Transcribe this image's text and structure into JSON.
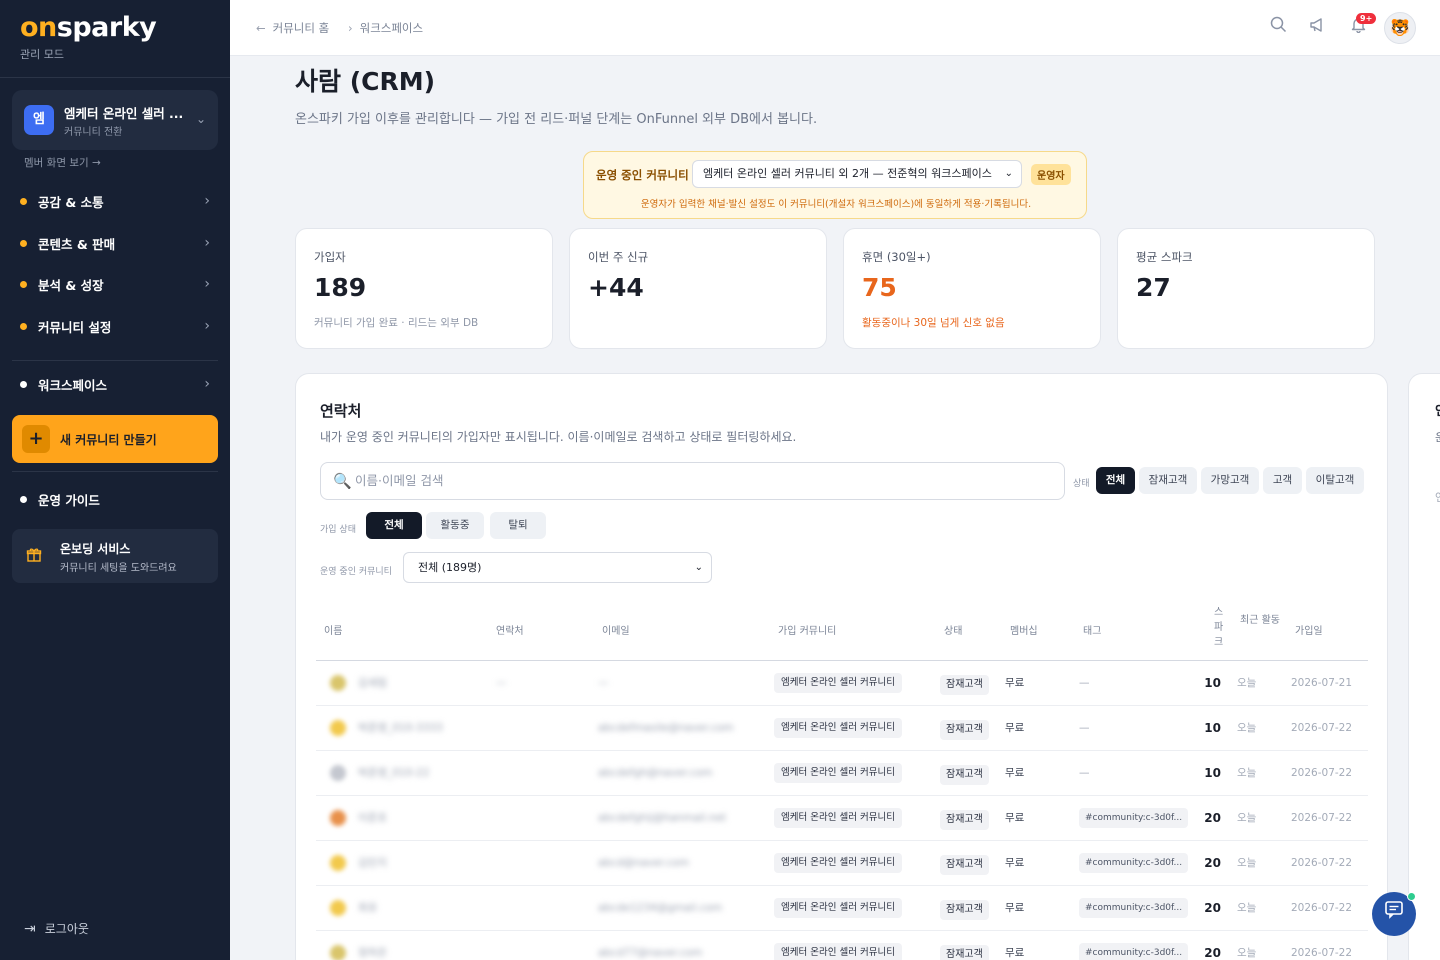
{
  "brand": {
    "on": "on",
    "sparky": "sparky",
    "mode": "관리 모드"
  },
  "switcher": {
    "avatar": "엠",
    "name": "엠케터 온라인 셀러 ...",
    "sub": "커뮤니티 전환"
  },
  "member_view": "멤버 화면 보기 →",
  "nav": [
    {
      "label": "공감 & 소통"
    },
    {
      "label": "콘텐츠 & 판매"
    },
    {
      "label": "분석 & 성장"
    },
    {
      "label": "커뮤니티 설정"
    },
    {
      "label": "워크스페이스"
    }
  ],
  "create_button": "새 커뮤니티 만들기",
  "guide": "운영 가이드",
  "onboarding": {
    "title": "온보딩 서비스",
    "sub": "커뮤니티 세팅을 도와드려요"
  },
  "logout": "로그아웃",
  "breadcrumb": {
    "home": "커뮤니티 홈",
    "workspace": "워크스페이스"
  },
  "notification_badge": "9+",
  "page": {
    "title": "사람 (CRM)",
    "subtitle": "온스파키 가입 이후를 관리합니다 — 가입 전 리드·퍼널 단계는 OnFunnel 외부 DB에서 봅니다."
  },
  "op_community": {
    "label": "운영 중인 커뮤니티",
    "selected": "엠케터 온라인 셀러 커뮤니티 외 2개 — 전준혁의 워크스페이스",
    "role": "운영자",
    "note": "운영자가 입력한 채널·발신 설정도 이 커뮤니티(개설자 워크스페이스)에 동일하게 적용·기록됩니다."
  },
  "stats": [
    {
      "label": "가입자",
      "value": "189",
      "note": "커뮤니티 가입 완료 · 리드는 외부 DB"
    },
    {
      "label": "이번 주 신규",
      "value": "+44",
      "note": ""
    },
    {
      "label": "휴면 (30일+)",
      "value": "75",
      "note": "활동중이나 30일 넘게 신호 없음"
    },
    {
      "label": "평균 스파크",
      "value": "27",
      "note": ""
    }
  ],
  "contacts": {
    "title": "연락처",
    "subtitle": "내가 운영 중인 커뮤니티의 가입자만 표시됩니다. 이름·이메일로 검색하고 상태로 필터링하세요.",
    "search_placeholder": "이름·이메일 검색",
    "status_label": "상태",
    "status_chips": [
      "전체",
      "잠재고객",
      "가망고객",
      "고객",
      "이탈고객"
    ],
    "join_label": "가입 상태",
    "join_chips": [
      "전체",
      "활동중",
      "탈퇴"
    ],
    "community_label": "운영 중인 커뮤니티",
    "community_selected": "전체 (189명)",
    "columns": [
      "이름",
      "연락처",
      "이메일",
      "가입 커뮤니티",
      "상태",
      "멤버십",
      "태그",
      "스파크",
      "최근 활동",
      "가입일"
    ],
    "rows": [
      {
        "name": "김세림",
        "phone": "—",
        "email": "—",
        "community": "엠케터 온라인 셀러 커뮤니티",
        "status": "잠재고객",
        "membership": "무료",
        "tag": "—",
        "spark": "10",
        "recent": "오늘",
        "joined": "2026-07-21",
        "avatar_color": "#d9c56b"
      },
      {
        "name": "박준영_010-3333",
        "phone": "",
        "email": "abcdefmasile@naver.com",
        "community": "엠케터 온라인 셀러 커뮤니티",
        "status": "잠재고객",
        "membership": "무료",
        "tag": "—",
        "spark": "10",
        "recent": "오늘",
        "joined": "2026-07-22",
        "avatar_color": "#f2c94c"
      },
      {
        "name": "박준영_010-22",
        "phone": "",
        "email": "abcdefgh@naver.com",
        "community": "엠케터 온라인 셀러 커뮤니티",
        "status": "잠재고객",
        "membership": "무료",
        "tag": "—",
        "spark": "10",
        "recent": "오늘",
        "joined": "2026-07-22",
        "avatar_color": "#c4c7cf"
      },
      {
        "name": "이준호",
        "phone": "",
        "email": "abcdefghij@hanmail.net",
        "community": "엠케터 온라인 셀러 커뮤니티",
        "status": "잠재고객",
        "membership": "무료",
        "tag": "#community:c-3d0f...",
        "spark": "20",
        "recent": "오늘",
        "joined": "2026-07-22",
        "avatar_color": "#e8904a"
      },
      {
        "name": "김민지",
        "phone": "",
        "email": "abcd@naver.com",
        "community": "엠케터 온라인 셀러 커뮤니티",
        "status": "잠재고객",
        "membership": "무료",
        "tag": "#community:c-3d0f...",
        "spark": "20",
        "recent": "오늘",
        "joined": "2026-07-22",
        "avatar_color": "#f2c94c"
      },
      {
        "name": "최유",
        "phone": "",
        "email": "abcde1234@gmail.com",
        "community": "엠케터 온라인 셀러 커뮤니티",
        "status": "잠재고객",
        "membership": "무료",
        "tag": "#community:c-3d0f...",
        "spark": "20",
        "recent": "오늘",
        "joined": "2026-07-22",
        "avatar_color": "#f2c94c"
      },
      {
        "name": "정하은",
        "phone": "",
        "email": "abcd77@naver.com",
        "community": "엠케터 온라인 셀러 커뮤니티",
        "status": "잠재고객",
        "membership": "무료",
        "tag": "#community:c-3d0f...",
        "spark": "20",
        "recent": "오늘",
        "joined": "2026-07-22",
        "avatar_color": "#d9c56b"
      }
    ]
  },
  "peek": {
    "title": "인",
    "line1": "운",
    "line2": "연"
  }
}
